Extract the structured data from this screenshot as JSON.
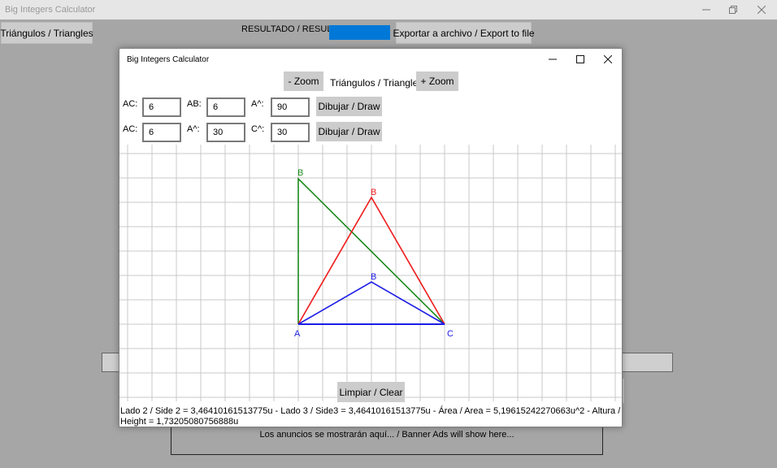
{
  "app": {
    "title": "Big Integers Calculator",
    "buttons": {
      "triangles": "Triángulos / Triangles",
      "export": "Exportar a archivo / Export to file"
    },
    "result_label": "RESULTADO / RESULT",
    "result_color": "#0078d7",
    "ads_text": "Los anuncios se mostrarán aquí... / Banner Ads will show here..."
  },
  "dialog": {
    "title": "Big Integers Calculator",
    "heading": "Triángulos / Triangles",
    "zoom_out": "- Zoom",
    "zoom_in": "+ Zoom",
    "row1": {
      "label_1": "AC:",
      "value_1": "6",
      "label_2": "AB:",
      "value_2": "6",
      "label_3": "A^:",
      "value_3": "90",
      "button": "Dibujar / Draw"
    },
    "row2": {
      "label_1": "AC:",
      "value_1": "6",
      "label_2": "A^:",
      "value_2": "30",
      "label_3": "C^:",
      "value_3": "30",
      "button": "Dibujar / Draw"
    },
    "clear_button": "Limpiar / Clear",
    "result_text": "Lado 2 / Side 2 = 3,46410161513775u - Lado 3 / Side3 = 3,46410161513775u - Área / Area = 5,19615242270663u^2 - Altura / Height = 1,73205080756888u",
    "canvas": {
      "vertex_labels": {
        "A": "A",
        "C": "C",
        "B": "B"
      },
      "colors": {
        "green": "#1a8a1a",
        "red": "#ee1c1c",
        "blue": "#1c1ce6",
        "grid": "#c8c8c8"
      }
    }
  }
}
